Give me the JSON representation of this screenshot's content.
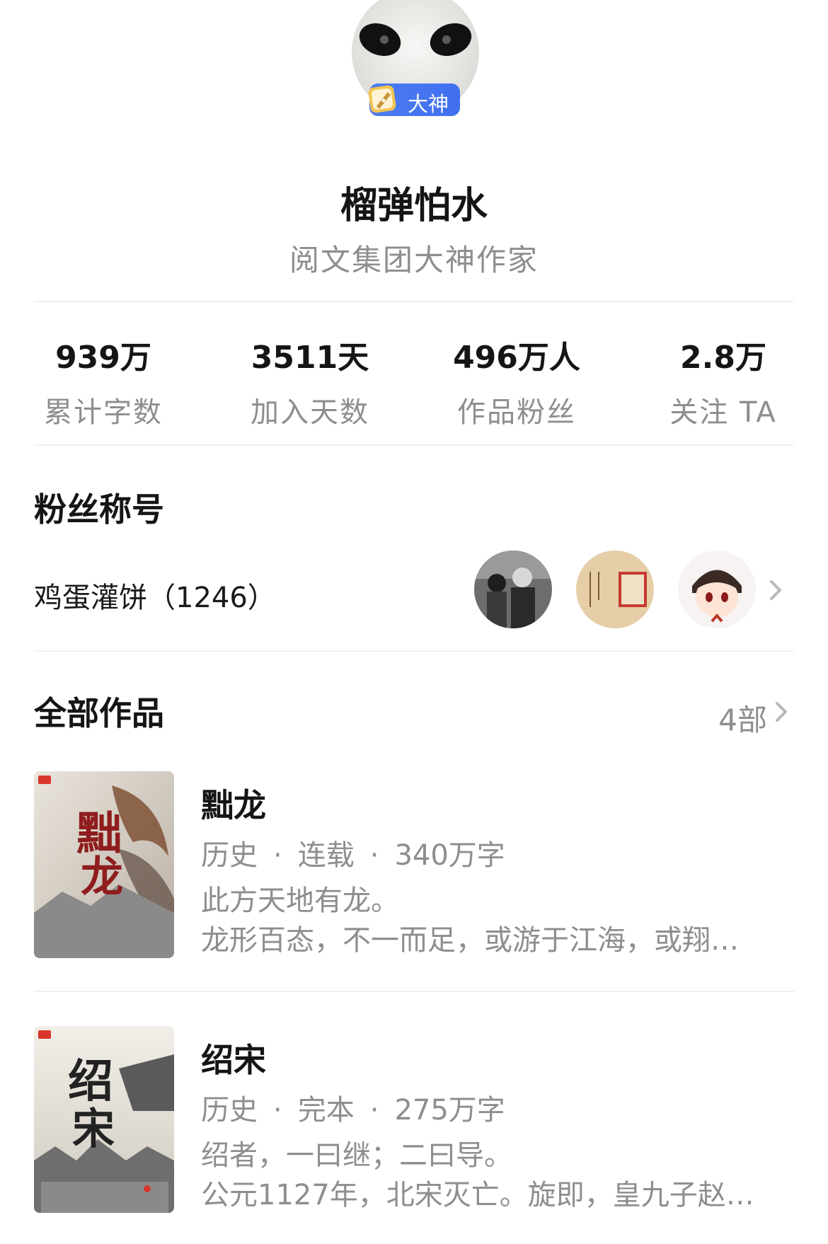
{
  "author": {
    "name": "榴弹怕水",
    "title": "阅文集团大神作家",
    "badge_label": "大神"
  },
  "stats": [
    {
      "value": "939万",
      "label": "累计字数"
    },
    {
      "value": "3511天",
      "label": "加入天数"
    },
    {
      "value": "496万人",
      "label": "作品粉丝"
    },
    {
      "value": "2.8万",
      "label": "关注 TA"
    }
  ],
  "fan_section": {
    "heading": "粉丝称号",
    "fan_title": "鸡蛋灌饼（1246）",
    "chevron_icon": "chevron-right-icon"
  },
  "works_section": {
    "heading": "全部作品",
    "count": "4部",
    "books": [
      {
        "title": "黜龙",
        "genre": "历史",
        "status": "连载",
        "words": "340万字",
        "dot": "·",
        "desc_line1": "此方天地有龙。",
        "desc_line2": "龙形百态，不一而足，或游于江海，或翔…"
      },
      {
        "title": "绍宋",
        "genre": "历史",
        "status": "完本",
        "words": "275万字",
        "dot": "·",
        "desc_line1": "绍者，一曰继；二曰导。",
        "desc_line2": "公元1127年，北宋灭亡。旋即，皇九子赵…"
      }
    ]
  },
  "colors": {
    "badge_blue": "#4f7cf2",
    "text_primary": "#151515",
    "text_secondary": "#8e8e8e",
    "divider": "#f0f0f0"
  }
}
